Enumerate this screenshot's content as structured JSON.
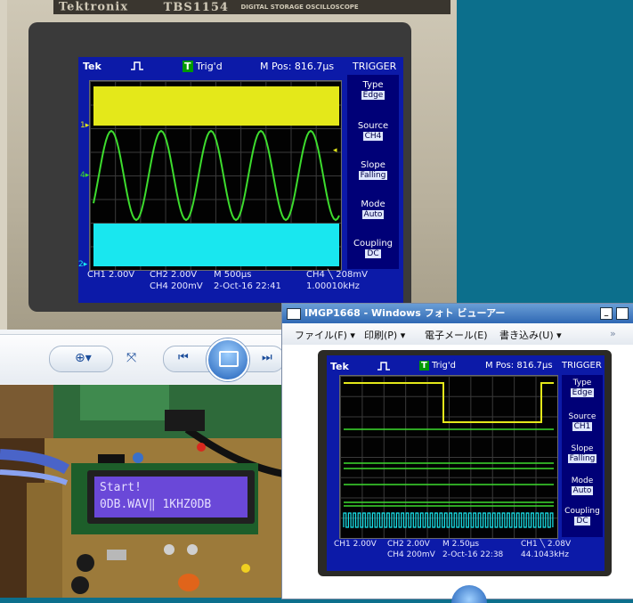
{
  "scope1": {
    "brand": "Tektronix",
    "model": "TBS1154",
    "model_sub": "DIGITAL STORAGE OSCILLOSCOPE",
    "tek": "Tek",
    "trig_status": "Trig'd",
    "mpos": "M Pos: 816.7µs",
    "menu_title": "TRIGGER",
    "menu": [
      {
        "label": "Type",
        "value": "Edge"
      },
      {
        "label": "Source",
        "value": "CH4"
      },
      {
        "label": "Slope",
        "value": "Falling"
      },
      {
        "label": "Mode",
        "value": "Auto"
      },
      {
        "label": "Coupling",
        "value": "DC"
      }
    ],
    "ch1": "CH1  2.00V",
    "ch2": "CH2  2.00V",
    "ch4": "CH4  200mV",
    "timebase": "M 500µs",
    "date": "2-Oct-16 22:41",
    "trig_level": "CH4 ╲ 208mV",
    "freq": "1.00010kHz"
  },
  "lcd_module": {
    "line1": "Start!",
    "line2": "0DB.WAV‖ 1KHZ0DB"
  },
  "viewer": {
    "title": "IMGP1668 - Windows フォト ビューアー",
    "menus": [
      "ファイル(F)",
      "印刷(P)",
      "電子メール(E)",
      "書き込み(U)"
    ],
    "more": "»"
  },
  "scope2": {
    "tek": "Tek",
    "trig_status": "Trig'd",
    "mpos": "M Pos: 816.7µs",
    "menu_title": "TRIGGER",
    "menu": [
      {
        "label": "Type",
        "value": "Edge"
      },
      {
        "label": "Source",
        "value": "CH1"
      },
      {
        "label": "Slope",
        "value": "Falling"
      },
      {
        "label": "Mode",
        "value": "Auto"
      },
      {
        "label": "Coupling",
        "value": "DC"
      }
    ],
    "ch1": "CH1  2.00V",
    "ch2": "CH2  2.00V",
    "ch4": "CH4  200mV",
    "timebase": "M 2.50µs",
    "date": "2-Oct-16 22:38",
    "trig_level": "CH1 ╲ 2.08V",
    "freq": "44.1043kHz"
  },
  "colors": {
    "ch1": "#e4e81a",
    "ch2": "#19e7ef",
    "ch4": "#3ddc2e",
    "lcd_bg": "#6a48d8",
    "screen_blue": "#0c1aa8"
  }
}
